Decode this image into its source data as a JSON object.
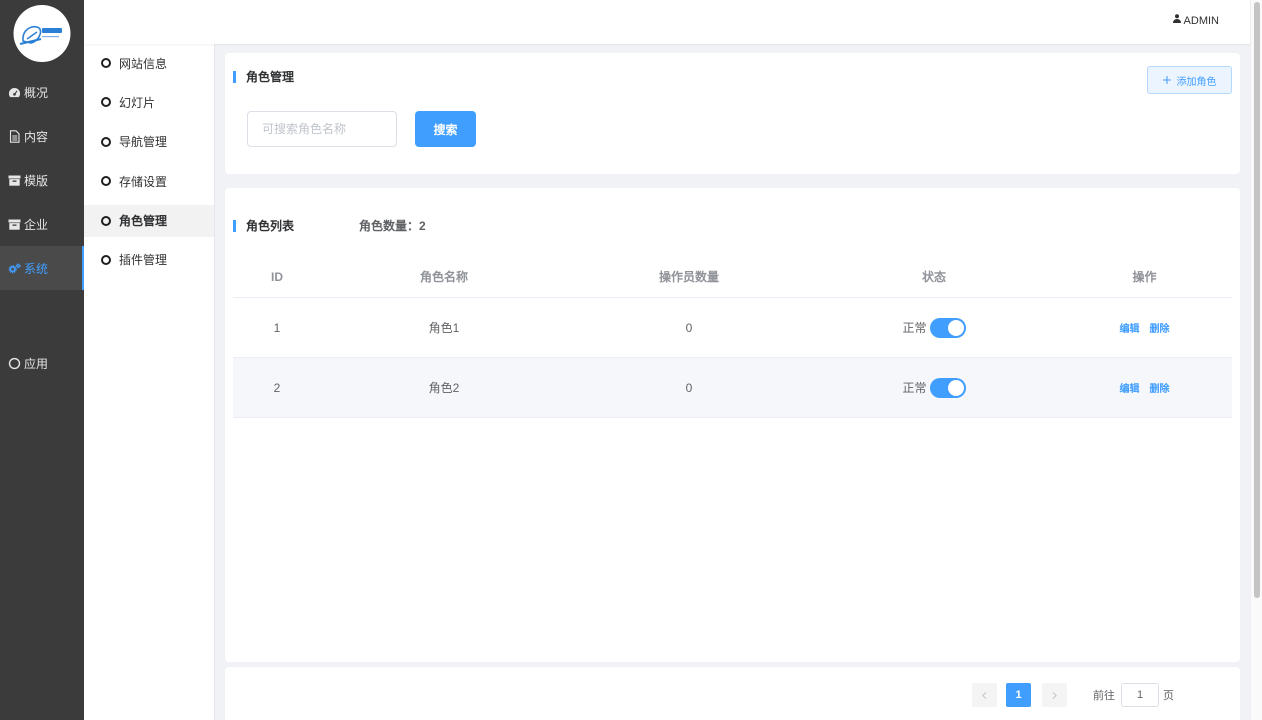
{
  "brand": {
    "logo_icon": "company-logo"
  },
  "header": {
    "user_icon": "user-icon",
    "username": "ADMIN"
  },
  "main_nav": {
    "items": [
      {
        "label": "概况",
        "icon": "dashboard-icon",
        "active": false
      },
      {
        "label": "内容",
        "icon": "file-text-icon",
        "active": false
      },
      {
        "label": "模版",
        "icon": "archive-icon",
        "active": false
      },
      {
        "label": "企业",
        "icon": "archive-icon",
        "active": false
      },
      {
        "label": "系统",
        "icon": "cogs-icon",
        "active": true
      },
      {
        "label": "应用",
        "icon": "circle-icon",
        "active": false
      }
    ]
  },
  "sub_nav": {
    "items": [
      {
        "label": "网站信息",
        "active": false
      },
      {
        "label": "幻灯片",
        "active": false
      },
      {
        "label": "导航管理",
        "active": false
      },
      {
        "label": "存储设置",
        "active": false
      },
      {
        "label": "角色管理",
        "active": true
      },
      {
        "label": "插件管理",
        "active": false
      }
    ]
  },
  "role_panel": {
    "title": "角色管理",
    "add_button": {
      "icon": "plus-icon",
      "label": "添加角色"
    },
    "search": {
      "placeholder": "可搜索角色名称",
      "value": "",
      "button": "搜索"
    }
  },
  "role_list": {
    "title": "角色列表",
    "count_label": "角色数量：",
    "count": "2",
    "columns": [
      "ID",
      "角色名称",
      "操作员数量",
      "状态",
      "操作"
    ],
    "rows": [
      {
        "id": "1",
        "name": "角色1",
        "operator_count": "0",
        "status": "正常",
        "enabled": true,
        "actions": [
          "编辑",
          "删除"
        ]
      },
      {
        "id": "2",
        "name": "角色2",
        "operator_count": "0",
        "status": "正常",
        "enabled": true,
        "actions": [
          "编辑",
          "删除"
        ]
      }
    ]
  },
  "pagination": {
    "prev_icon": "chevron-left-icon",
    "current_page": "1",
    "next_icon": "chevron-right-icon",
    "goto_label": "前往",
    "goto_value": "1",
    "page_suffix": "页"
  },
  "theme": {
    "accent": "#409eff",
    "sidebar_bg": "#3b3b3b",
    "page_bg": "#f0f2f5"
  }
}
